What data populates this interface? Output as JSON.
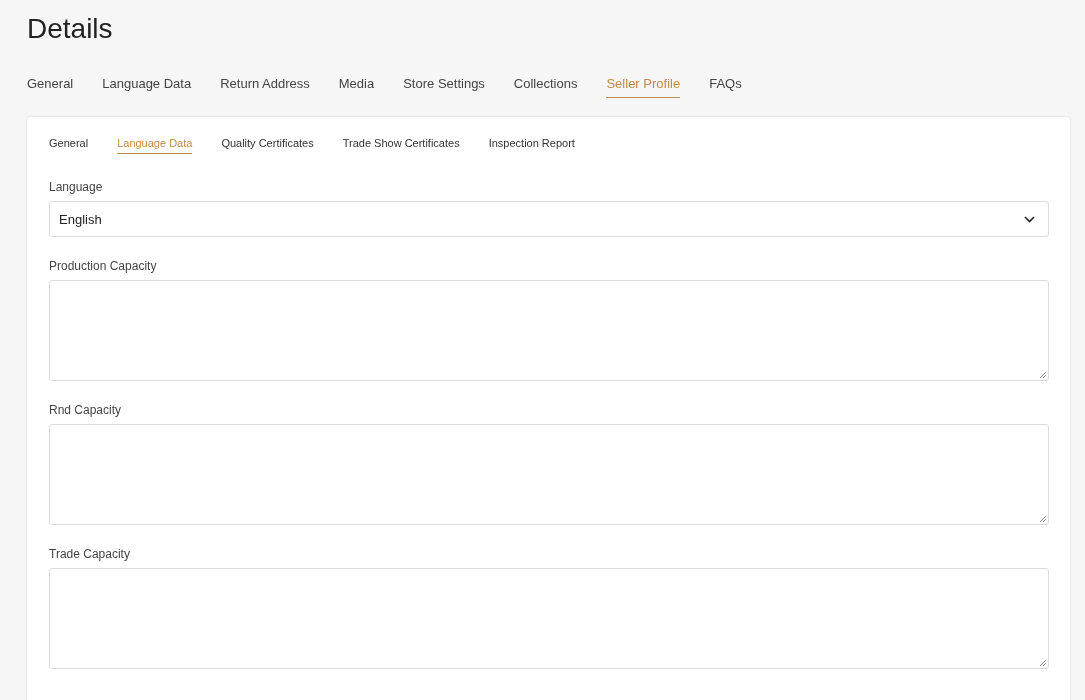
{
  "title": "Details",
  "tabs": [
    {
      "label": "General",
      "selected": false
    },
    {
      "label": "Language Data",
      "selected": false
    },
    {
      "label": "Return Address",
      "selected": false
    },
    {
      "label": "Media",
      "selected": false
    },
    {
      "label": "Store Settings",
      "selected": false
    },
    {
      "label": "Collections",
      "selected": false
    },
    {
      "label": "Seller Profile",
      "selected": true
    },
    {
      "label": "FAQs",
      "selected": false
    }
  ],
  "subtabs": [
    {
      "label": "General",
      "selected": false
    },
    {
      "label": "Language Data",
      "selected": true
    },
    {
      "label": "Quality Certificates",
      "selected": false
    },
    {
      "label": "Trade Show Certificates",
      "selected": false
    },
    {
      "label": "Inspection Report",
      "selected": false
    }
  ],
  "fields": [
    {
      "kind": "select",
      "label": "Language",
      "value": "English"
    },
    {
      "kind": "textarea",
      "label": "Production Capacity"
    },
    {
      "kind": "textarea",
      "label": "Rnd Capacity"
    },
    {
      "kind": "textarea",
      "label": "Trade Capacity"
    }
  ]
}
